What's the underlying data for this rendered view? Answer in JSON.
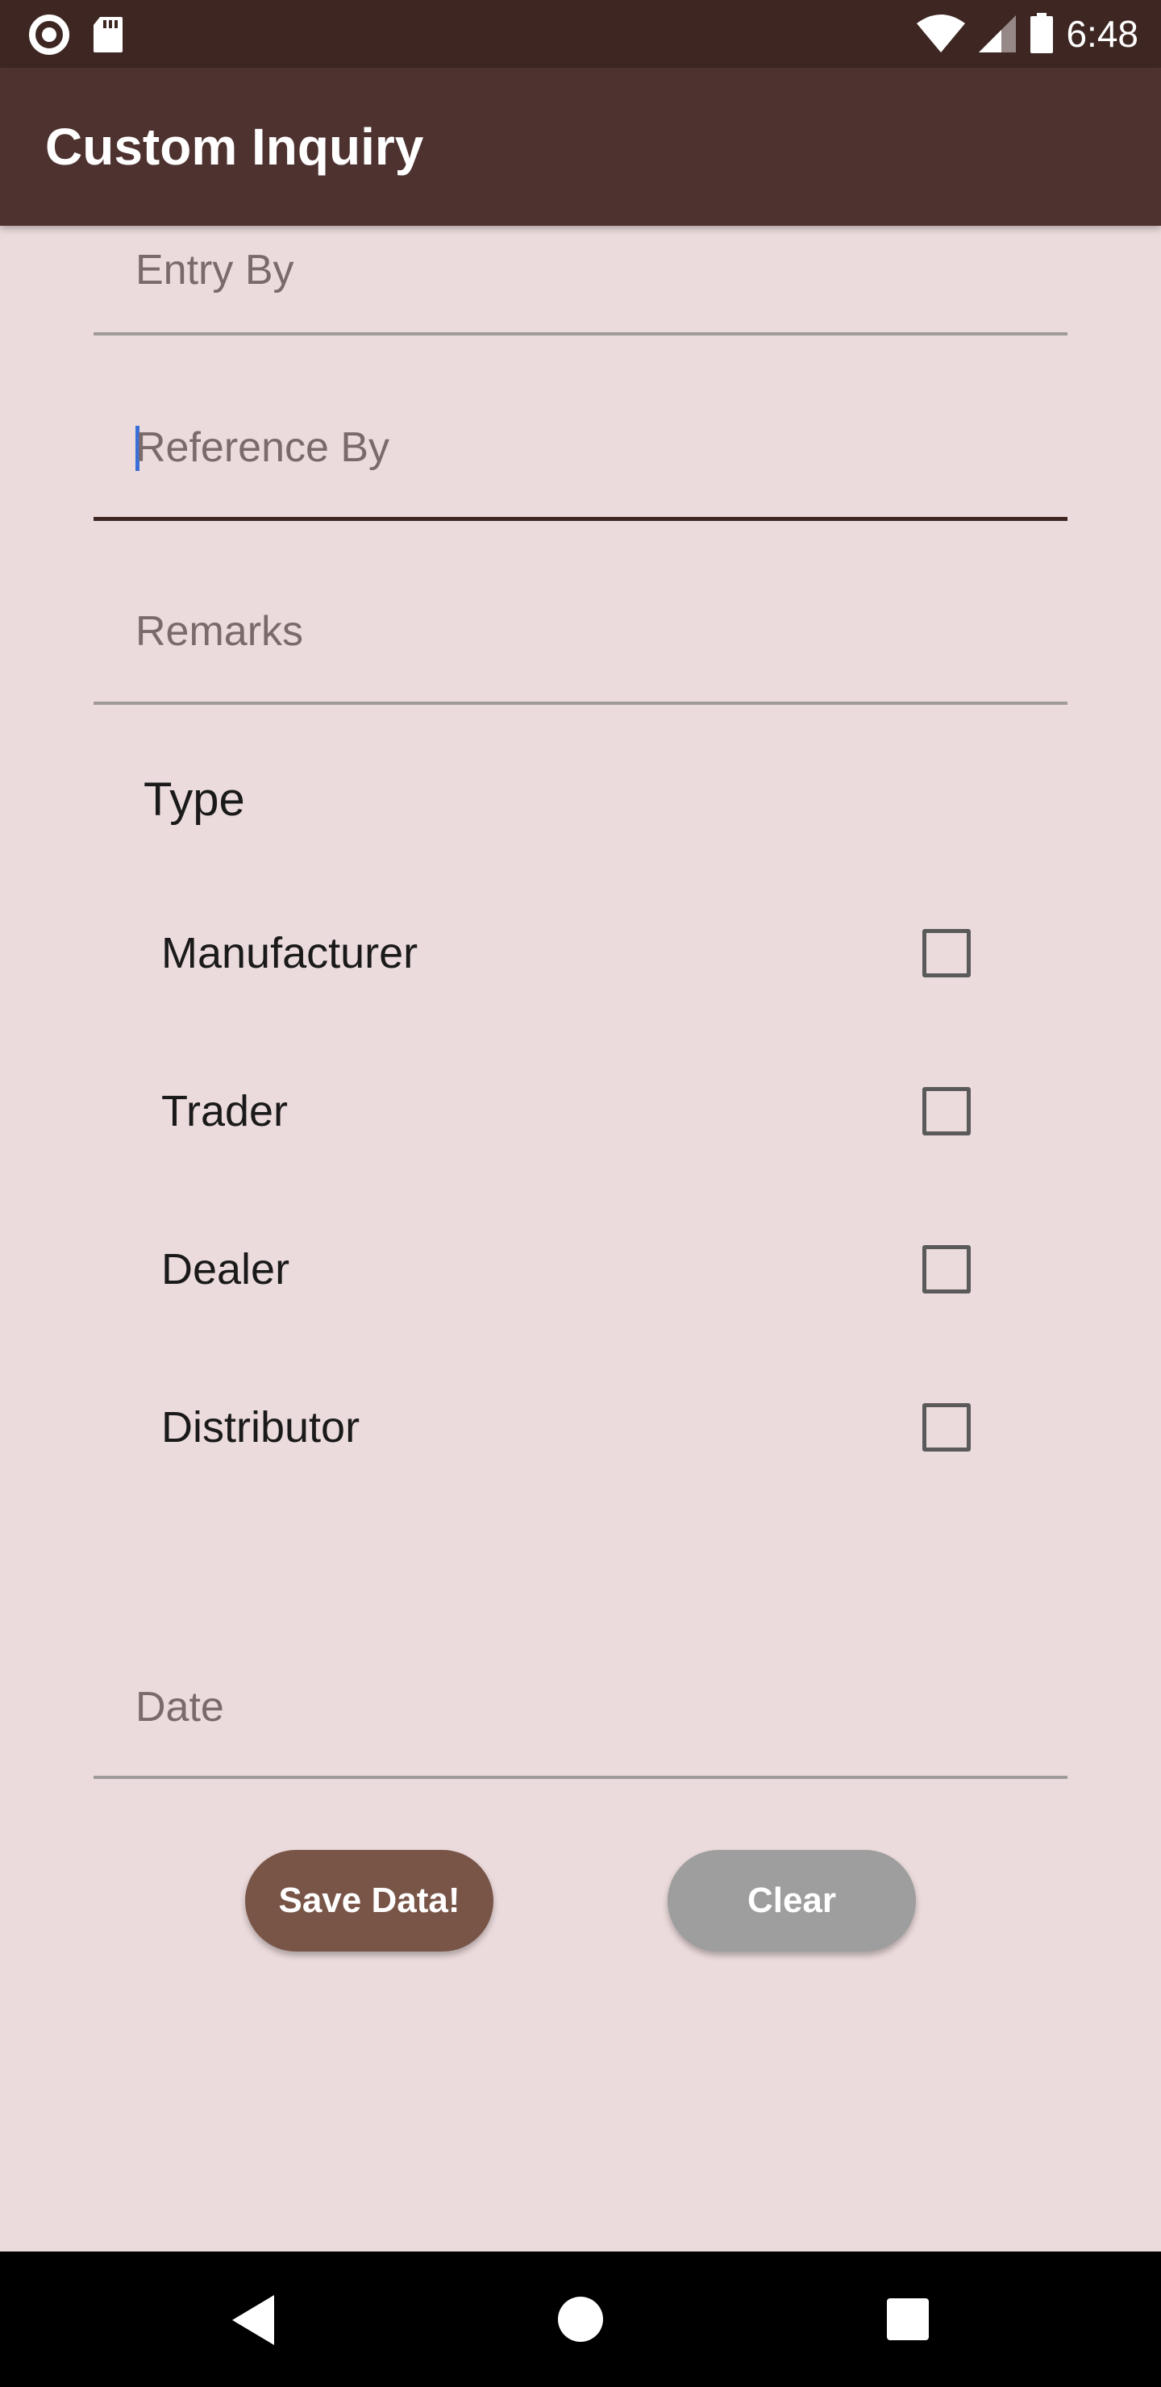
{
  "status_bar": {
    "time": "6:48",
    "icons": [
      "record-icon",
      "sd-card-icon",
      "wifi-icon",
      "signal-icon",
      "battery-icon"
    ]
  },
  "app_bar": {
    "title": "Custom Inquiry"
  },
  "form": {
    "fields": [
      {
        "label": "Entry By",
        "value": ""
      },
      {
        "label": "Reference By",
        "value": "",
        "focused": true
      },
      {
        "label": "Remarks",
        "value": ""
      },
      {
        "label": "Date",
        "value": ""
      }
    ],
    "type_section": {
      "heading": "Type",
      "options": [
        {
          "label": "Manufacturer",
          "checked": false
        },
        {
          "label": "Trader",
          "checked": false
        },
        {
          "label": "Dealer",
          "checked": false
        },
        {
          "label": "Distributor",
          "checked": false
        }
      ]
    }
  },
  "buttons": {
    "save_label": "Save Data!",
    "clear_label": "Clear"
  },
  "colors": {
    "status_bar": "#3e2723",
    "app_bar": "#4e3230",
    "background": "#ecdbdc",
    "save_button": "#795548",
    "clear_button": "#9e9e9e"
  },
  "nav_bar": {
    "icons": [
      "back-icon",
      "home-icon",
      "recents-icon"
    ]
  }
}
